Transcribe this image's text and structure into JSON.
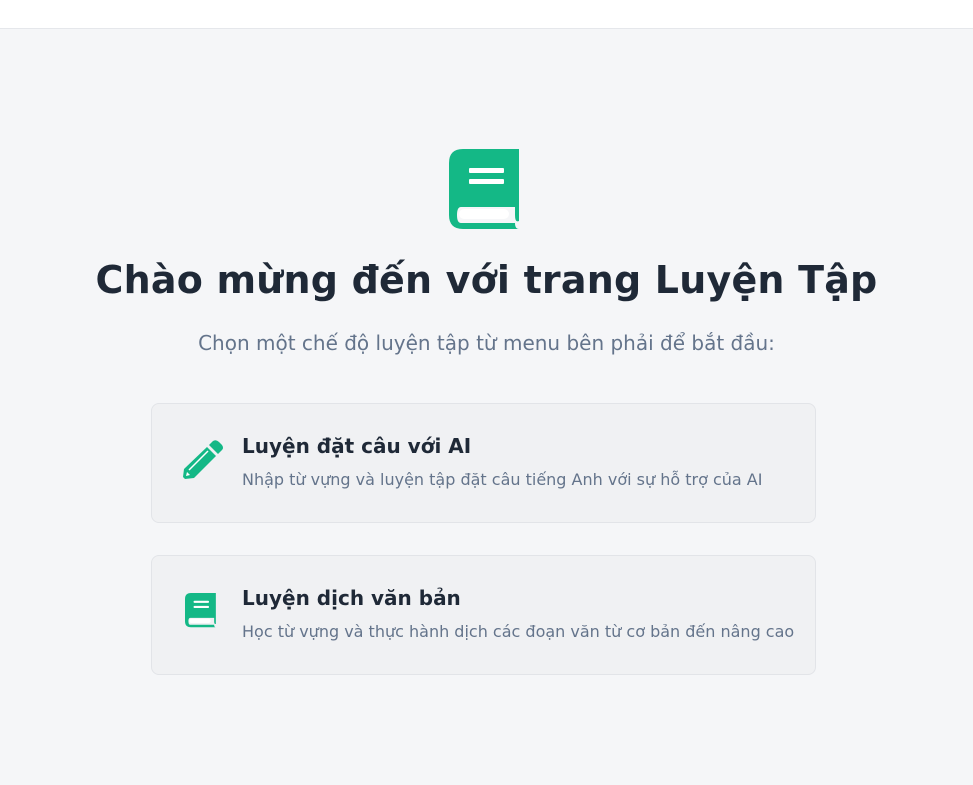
{
  "header": {},
  "hero": {
    "icon": "book-icon",
    "title": "Chào mừng đến với trang Luyện Tập",
    "subtitle": "Chọn một chế độ luyện tập từ menu bên phải để bắt đầu:"
  },
  "options": [
    {
      "icon": "pencil-icon",
      "title": "Luyện đặt câu với AI",
      "description": "Nhập từ vựng và luyện tập đặt câu tiếng Anh với sự hỗ trợ của AI"
    },
    {
      "icon": "book-icon",
      "title": "Luyện dịch văn bản",
      "description": "Học từ vựng và thực hành dịch các đoạn văn từ cơ bản đến nâng cao"
    }
  ],
  "colors": {
    "accent": "#14b886",
    "heading": "#1f2937",
    "muted": "#64748b",
    "background": "#f5f6f8",
    "card": "#f0f1f3"
  }
}
